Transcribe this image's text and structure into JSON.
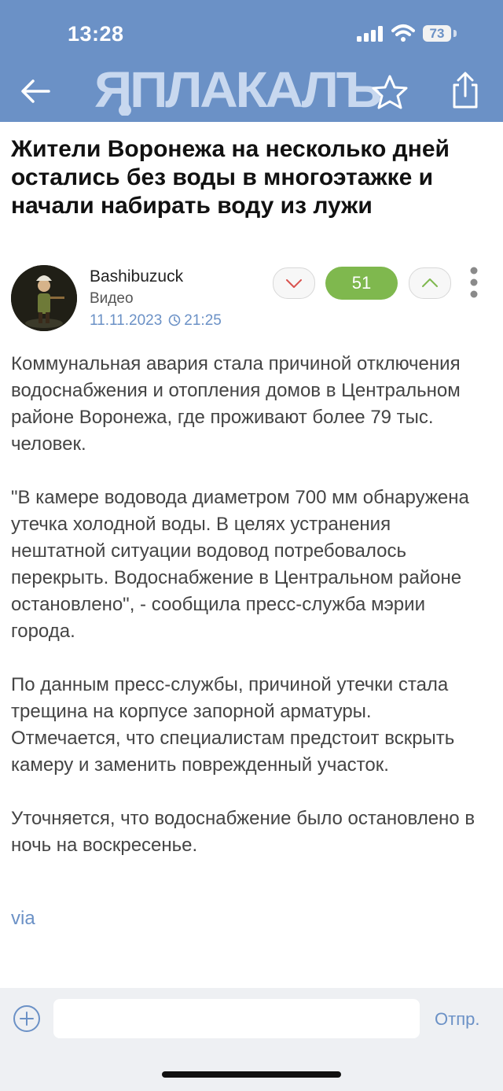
{
  "status_bar": {
    "time": "13:28",
    "battery": "73"
  },
  "header": {
    "logo": "ЯПЛАКАЛЪ"
  },
  "article": {
    "title": "Жители Воронежа на несколько дней остались без воды в многоэтажке и начали набирать воду из лужи",
    "author": "Bashibuzuck",
    "category": "Видео",
    "date": "11.11.2023",
    "time": "21:25",
    "score": "51",
    "paragraphs": [
      "Коммунальная авария стала причиной отключения водоснабжения и отопления домов в Центральном районе Воронежа, где проживают более 79 тыс. человек.",
      "\"В камере водовода диаметром 700 мм обнаружена утечка холодной воды. В целях устранения нештатной ситуации водовод потребовалось перекрыть. Водоснабжение в Центральном районе остановлено\", - сообщила пресс-служба мэрии города.",
      "По данным пресс-службы, причиной утечки стала трещина на корпусе запорной арматуры. Отмечается, что специалистам предстоит вскрыть камеру и заменить поврежденный участок.",
      "Уточняется, что водоснабжение было остановлено в ночь на воскресенье."
    ],
    "via": "via"
  },
  "comment_bar": {
    "placeholder": "",
    "send_label": "Отпр."
  },
  "colors": {
    "header_bg": "#6b91c6",
    "score_bg": "#7fb84e",
    "link": "#6b91c6"
  },
  "icons": [
    "back-arrow-icon",
    "star-icon",
    "share-icon",
    "vote-down-icon",
    "vote-up-icon",
    "more-icon",
    "clock-icon",
    "plus-icon"
  ]
}
